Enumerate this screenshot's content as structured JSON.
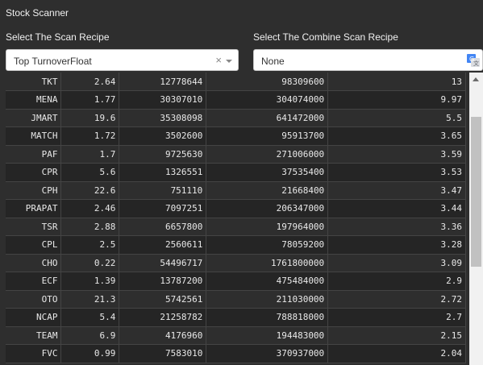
{
  "app": {
    "title": "Stock Scanner"
  },
  "scan_recipe": {
    "label": "Select The Scan Recipe",
    "value": "Top TurnoverFloat",
    "clear_glyph": "×"
  },
  "combine_recipe": {
    "label": "Select The Combine Scan Recipe",
    "value": "None",
    "icon": "google-translate-icon"
  },
  "table": {
    "rows": [
      [
        "TKT",
        "2.64",
        "12778644",
        "98309600",
        "13"
      ],
      [
        "MENA",
        "1.77",
        "30307010",
        "304074000",
        "9.97"
      ],
      [
        "JMART",
        "19.6",
        "35308098",
        "641472000",
        "5.5"
      ],
      [
        "MATCH",
        "1.72",
        "3502600",
        "95913700",
        "3.65"
      ],
      [
        "PAF",
        "1.7",
        "9725630",
        "271006000",
        "3.59"
      ],
      [
        "CPR",
        "5.6",
        "1326551",
        "37535400",
        "3.53"
      ],
      [
        "CPH",
        "22.6",
        "751110",
        "21668400",
        "3.47"
      ],
      [
        "PRAPAT",
        "2.46",
        "7097251",
        "206347000",
        "3.44"
      ],
      [
        "TSR",
        "2.88",
        "6657800",
        "197964000",
        "3.36"
      ],
      [
        "CPL",
        "2.5",
        "2560611",
        "78059200",
        "3.28"
      ],
      [
        "CHO",
        "0.22",
        "54496717",
        "1761800000",
        "3.09"
      ],
      [
        "ECF",
        "1.39",
        "13787200",
        "475484000",
        "2.9"
      ],
      [
        "OTO",
        "21.3",
        "5742561",
        "211030000",
        "2.72"
      ],
      [
        "NCAP",
        "5.4",
        "21258782",
        "788818000",
        "2.7"
      ],
      [
        "TEAM",
        "6.9",
        "4176960",
        "194483000",
        "2.15"
      ],
      [
        "FVC",
        "0.99",
        "7583010",
        "370937000",
        "2.04"
      ]
    ]
  },
  "colors": {
    "background": "#2e2e2e",
    "row_alt": "#252525",
    "scrollbar_track": "#f1f1f1",
    "scrollbar_thumb": "#c1c1c1"
  }
}
